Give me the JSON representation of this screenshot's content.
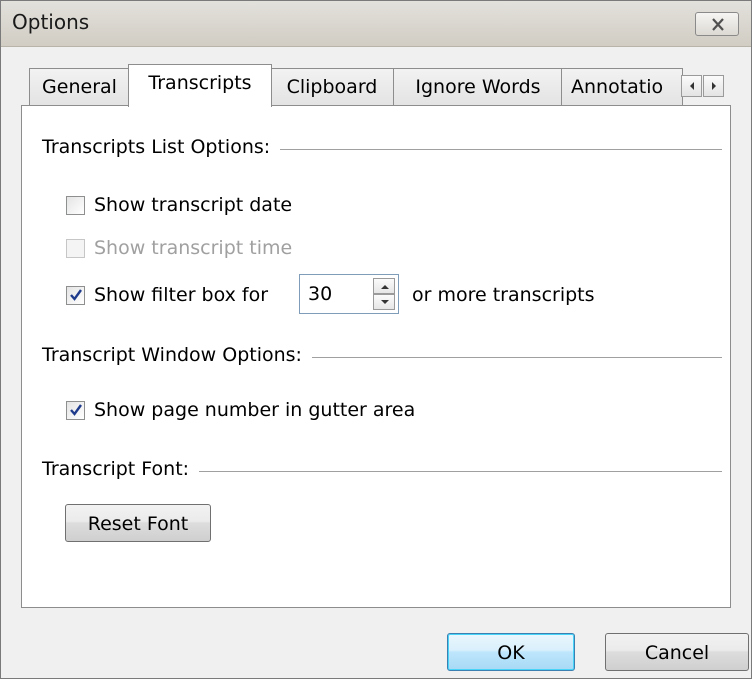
{
  "window": {
    "title": "Options"
  },
  "tabs": [
    {
      "label": "General",
      "active": false
    },
    {
      "label": "Transcripts",
      "active": true
    },
    {
      "label": "Clipboard",
      "active": false
    },
    {
      "label": "Ignore Words",
      "active": false
    },
    {
      "label": "Annotatio",
      "active": false
    }
  ],
  "groups": {
    "list": {
      "label": "Transcripts List Options:",
      "show_date": {
        "label": "Show transcript date",
        "checked": false,
        "enabled": true
      },
      "show_time": {
        "label": "Show transcript time",
        "checked": false,
        "enabled": false
      },
      "filter_box": {
        "label": "Show filter box for",
        "checked": true,
        "value": "30",
        "suffix": "or more transcripts"
      }
    },
    "window": {
      "label": "Transcript Window Options:",
      "page_number": {
        "label": "Show page number in gutter area",
        "checked": true
      }
    },
    "font": {
      "label": "Transcript Font:",
      "reset_label": "Reset Font"
    }
  },
  "footer": {
    "ok_label": "OK",
    "cancel_label": "Cancel"
  },
  "icons": {
    "close": "close-x-icon",
    "tab_left": "arrow-left-icon",
    "tab_right": "arrow-right-icon",
    "spin_up": "spin-up-icon",
    "spin_down": "spin-down-icon",
    "check": "checkmark-icon"
  },
  "colors": {
    "checkmark": "#1f3b8c",
    "default_button_border": "#3c7fb1"
  }
}
